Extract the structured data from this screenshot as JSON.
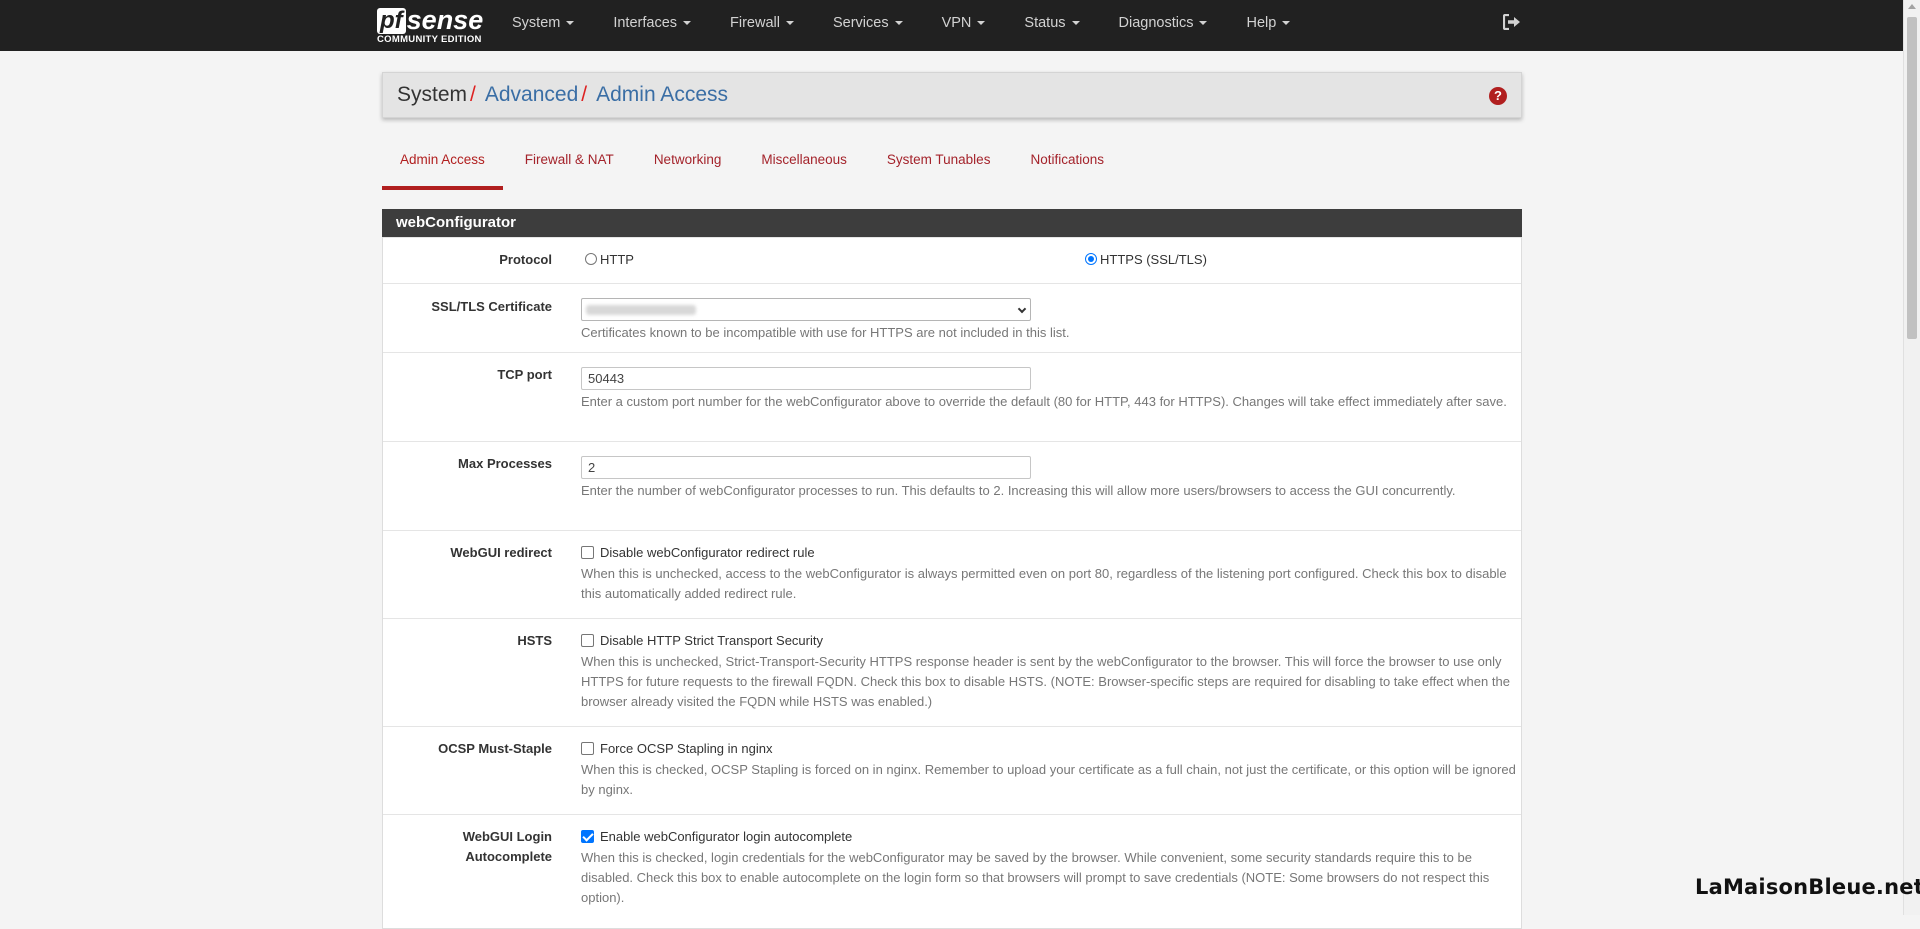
{
  "brand": {
    "logo_pf": "pf",
    "logo_sense": "sense",
    "edition": "COMMUNITY EDITION"
  },
  "nav": {
    "items": [
      "System",
      "Interfaces",
      "Firewall",
      "Services",
      "VPN",
      "Status",
      "Diagnostics",
      "Help"
    ],
    "logout_icon": "sign-out-icon"
  },
  "breadcrumb": {
    "items": [
      "System",
      "Advanced",
      "Admin Access"
    ],
    "separator": "/",
    "help_icon": "question-circle-icon"
  },
  "tabs": [
    "Admin Access",
    "Firewall & NAT",
    "Networking",
    "Miscellaneous",
    "System Tunables",
    "Notifications"
  ],
  "active_tab": "Admin Access",
  "panel": {
    "title": "webConfigurator",
    "protocol": {
      "label": "Protocol",
      "options": [
        "HTTP",
        "HTTPS (SSL/TLS)"
      ],
      "selected": "HTTPS (SSL/TLS)"
    },
    "ssl_cert": {
      "label": "SSL/TLS Certificate",
      "help": "Certificates known to be incompatible with use for HTTPS are not included in this list."
    },
    "tcp_port": {
      "label": "TCP port",
      "value": "50443",
      "help": "Enter a custom port number for the webConfigurator above to override the default (80 for HTTP, 443 for HTTPS). Changes will take effect immediately after save."
    },
    "max_processes": {
      "label": "Max Processes",
      "value": "2",
      "help": "Enter the number of webConfigurator processes to run. This defaults to 2. Increasing this will allow more users/browsers to access the GUI concurrently."
    },
    "webgui_redirect": {
      "label": "WebGUI redirect",
      "checkbox": "Disable webConfigurator redirect rule",
      "checked": false,
      "help": "When this is unchecked, access to the webConfigurator is always permitted even on port 80, regardless of the listening port configured. Check this box to disable this automatically added redirect rule."
    },
    "hsts": {
      "label": "HSTS",
      "checkbox": "Disable HTTP Strict Transport Security",
      "checked": false,
      "help": "When this is unchecked, Strict-Transport-Security HTTPS response header is sent by the webConfigurator to the browser. This will force the browser to use only HTTPS for future requests to the firewall FQDN. Check this box to disable HSTS. (NOTE: Browser-specific steps are required for disabling to take effect when the browser already visited the FQDN while HSTS was enabled.)"
    },
    "ocsp": {
      "label": "OCSP Must-Staple",
      "checkbox": "Force OCSP Stapling in nginx",
      "checked": false,
      "help": "When this is checked, OCSP Stapling is forced on in nginx. Remember to upload your certificate as a full chain, not just the certificate, or this option will be ignored by nginx."
    },
    "login_autocomplete": {
      "label_line1": "WebGUI Login",
      "label_line2": "Autocomplete",
      "checkbox": "Enable webConfigurator login autocomplete",
      "checked": true,
      "help": "When this is checked, login credentials for the webConfigurator may be saved by the browser. While convenient, some security standards require this to be disabled. Check this box to enable autocomplete on the login form so that browsers will prompt to save credentials (NOTE: Some browsers do not respect this option)."
    }
  },
  "watermark": "LaMaisonBleue.net"
}
